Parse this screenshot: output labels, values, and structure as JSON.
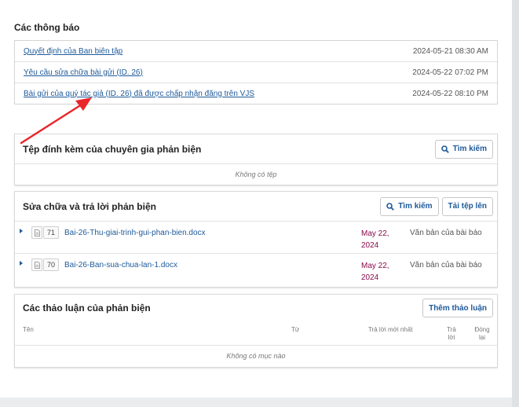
{
  "notifications": {
    "heading": "Các thông báo",
    "items": [
      {
        "label": "Quyết định của Ban biên tập",
        "date": "2024-05-21 08:30 AM"
      },
      {
        "label": "Yêu cầu sửa chữa bài gửi (ID. 26)",
        "date": "2024-05-22 07:02 PM"
      },
      {
        "label": "Bài gửi của quý tác giả (ID. 26) đã được chấp nhận đăng trên VJS",
        "date": "2024-05-22 08:10 PM"
      }
    ]
  },
  "reviewer_files": {
    "title": "Tệp đính kèm của chuyên gia phản biện",
    "search_label": "Tìm kiếm",
    "empty_text": "Không có tệp"
  },
  "revisions": {
    "title": "Sửa chữa và trả lời phản biện",
    "search_label": "Tìm kiếm",
    "upload_label": "Tải tệp lên",
    "files": [
      {
        "id": "71",
        "name": "Bai-26-Thu-giai-trinh-gui-phan-bien.docx",
        "date_line1": "May 22,",
        "date_line2": "2024",
        "type": "Văn bản của bài báo"
      },
      {
        "id": "70",
        "name": "Bai-26-Ban-sua-chua-lan-1.docx",
        "date_line1": "May 22,",
        "date_line2": "2024",
        "type": "Văn bản của bài báo"
      }
    ]
  },
  "discussions": {
    "title": "Các thảo luận của phản biện",
    "add_label": "Thêm thảo luận",
    "columns": {
      "name": "Tên",
      "from": "Từ",
      "last_reply": "Trả lời mới nhất",
      "replies_1": "Trả",
      "replies_2": "lời",
      "closed_1": "Đóng",
      "closed_2": "lại"
    },
    "empty_text": "Không có mục nào"
  },
  "colors": {
    "link": "#1e5a9a",
    "date_accent": "#8b0a4b",
    "arrow": "#e8262b"
  },
  "icons": [
    "search-icon",
    "document-icon",
    "expand-arrow-icon"
  ]
}
